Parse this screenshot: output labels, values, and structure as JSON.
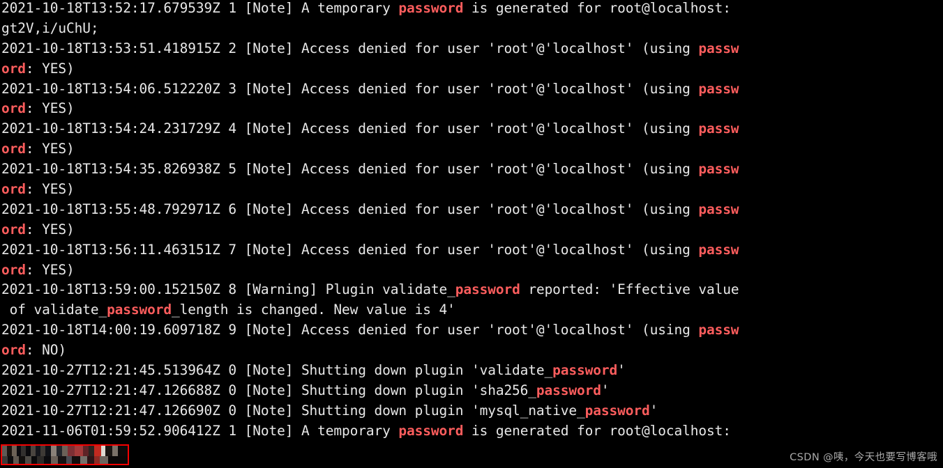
{
  "terminal": {
    "background_color": "#000000",
    "text_color": "#e8e8e8",
    "highlight_color": "#fd5d5d",
    "font_size_px": 19.5,
    "line_height_px": 28.9,
    "wrap_columns": 84,
    "lines": [
      {
        "id": "line-1",
        "segments": [
          {
            "t": "2021-10-18T13:52:17.679539Z 1 [Note] A temporary ",
            "h": false
          },
          {
            "t": "password",
            "h": true
          },
          {
            "t": " is generated for root@localhost:",
            "h": false
          }
        ]
      },
      {
        "id": "line-2",
        "segments": [
          {
            "t": "gt2V,i/uChU;",
            "h": false
          }
        ]
      },
      {
        "id": "line-3",
        "segments": [
          {
            "t": "2021-10-18T13:53:51.418915Z 2 [Note] Access denied for user 'root'@'localhost' (using ",
            "h": false
          },
          {
            "t": "passw",
            "h": true
          }
        ]
      },
      {
        "id": "line-4",
        "segments": [
          {
            "t": "ord",
            "h": true
          },
          {
            "t": ": YES)",
            "h": false
          }
        ]
      },
      {
        "id": "line-5",
        "segments": [
          {
            "t": "2021-10-18T13:54:06.512220Z 3 [Note] Access denied for user 'root'@'localhost' (using ",
            "h": false
          },
          {
            "t": "passw",
            "h": true
          }
        ]
      },
      {
        "id": "line-6",
        "segments": [
          {
            "t": "ord",
            "h": true
          },
          {
            "t": ": YES)",
            "h": false
          }
        ]
      },
      {
        "id": "line-7",
        "segments": [
          {
            "t": "2021-10-18T13:54:24.231729Z 4 [Note] Access denied for user 'root'@'localhost' (using ",
            "h": false
          },
          {
            "t": "passw",
            "h": true
          }
        ]
      },
      {
        "id": "line-8",
        "segments": [
          {
            "t": "ord",
            "h": true
          },
          {
            "t": ": YES)",
            "h": false
          }
        ]
      },
      {
        "id": "line-9",
        "segments": [
          {
            "t": "2021-10-18T13:54:35.826938Z 5 [Note] Access denied for user 'root'@'localhost' (using ",
            "h": false
          },
          {
            "t": "passw",
            "h": true
          }
        ]
      },
      {
        "id": "line-10",
        "segments": [
          {
            "t": "ord",
            "h": true
          },
          {
            "t": ": YES)",
            "h": false
          }
        ]
      },
      {
        "id": "line-11",
        "segments": [
          {
            "t": "2021-10-18T13:55:48.792971Z 6 [Note] Access denied for user 'root'@'localhost' (using ",
            "h": false
          },
          {
            "t": "passw",
            "h": true
          }
        ]
      },
      {
        "id": "line-12",
        "segments": [
          {
            "t": "ord",
            "h": true
          },
          {
            "t": ": YES)",
            "h": false
          }
        ]
      },
      {
        "id": "line-13",
        "segments": [
          {
            "t": "2021-10-18T13:56:11.463151Z 7 [Note] Access denied for user 'root'@'localhost' (using ",
            "h": false
          },
          {
            "t": "passw",
            "h": true
          }
        ]
      },
      {
        "id": "line-14",
        "segments": [
          {
            "t": "ord",
            "h": true
          },
          {
            "t": ": YES)",
            "h": false
          }
        ]
      },
      {
        "id": "line-15",
        "segments": [
          {
            "t": "2021-10-18T13:59:00.152150Z 8 [Warning] Plugin validate_",
            "h": false
          },
          {
            "t": "password",
            "h": true
          },
          {
            "t": " reported: 'Effective value",
            "h": false
          }
        ]
      },
      {
        "id": "line-16",
        "segments": [
          {
            "t": " of validate_",
            "h": false
          },
          {
            "t": "password",
            "h": true
          },
          {
            "t": "_length is changed. New value is 4'",
            "h": false
          }
        ]
      },
      {
        "id": "line-17",
        "segments": [
          {
            "t": "2021-10-18T14:00:19.609718Z 9 [Note] Access denied for user 'root'@'localhost' (using ",
            "h": false
          },
          {
            "t": "passw",
            "h": true
          }
        ]
      },
      {
        "id": "line-18",
        "segments": [
          {
            "t": "ord",
            "h": true
          },
          {
            "t": ": NO)",
            "h": false
          }
        ]
      },
      {
        "id": "line-19",
        "segments": [
          {
            "t": "2021-10-27T12:21:45.513964Z 0 [Note] Shutting down plugin 'validate_",
            "h": false
          },
          {
            "t": "password",
            "h": true
          },
          {
            "t": "'",
            "h": false
          }
        ]
      },
      {
        "id": "line-20",
        "segments": [
          {
            "t": "2021-10-27T12:21:47.126688Z 0 [Note] Shutting down plugin 'sha256_",
            "h": false
          },
          {
            "t": "password",
            "h": true
          },
          {
            "t": "'",
            "h": false
          }
        ]
      },
      {
        "id": "line-21",
        "segments": [
          {
            "t": "2021-10-27T12:21:47.126690Z 0 [Note] Shutting down plugin 'mysql_native_",
            "h": false
          },
          {
            "t": "password",
            "h": true
          },
          {
            "t": "'",
            "h": false
          }
        ]
      },
      {
        "id": "line-22",
        "segments": [
          {
            "t": "2021-11-06T01:59:52.906412Z 1 [Note] A temporary ",
            "h": false
          },
          {
            "t": "password",
            "h": true
          },
          {
            "t": " is generated for root@localhost:",
            "h": false
          }
        ]
      }
    ]
  },
  "redaction": {
    "label": "",
    "border_color": "#f50000",
    "note": "pixelated censored shell prompt"
  },
  "bottom_cut_line": {
    "text": ""
  },
  "watermark": {
    "text": "CSDN @咦，今天也要写博客哦",
    "color": "#b9b9b9"
  }
}
